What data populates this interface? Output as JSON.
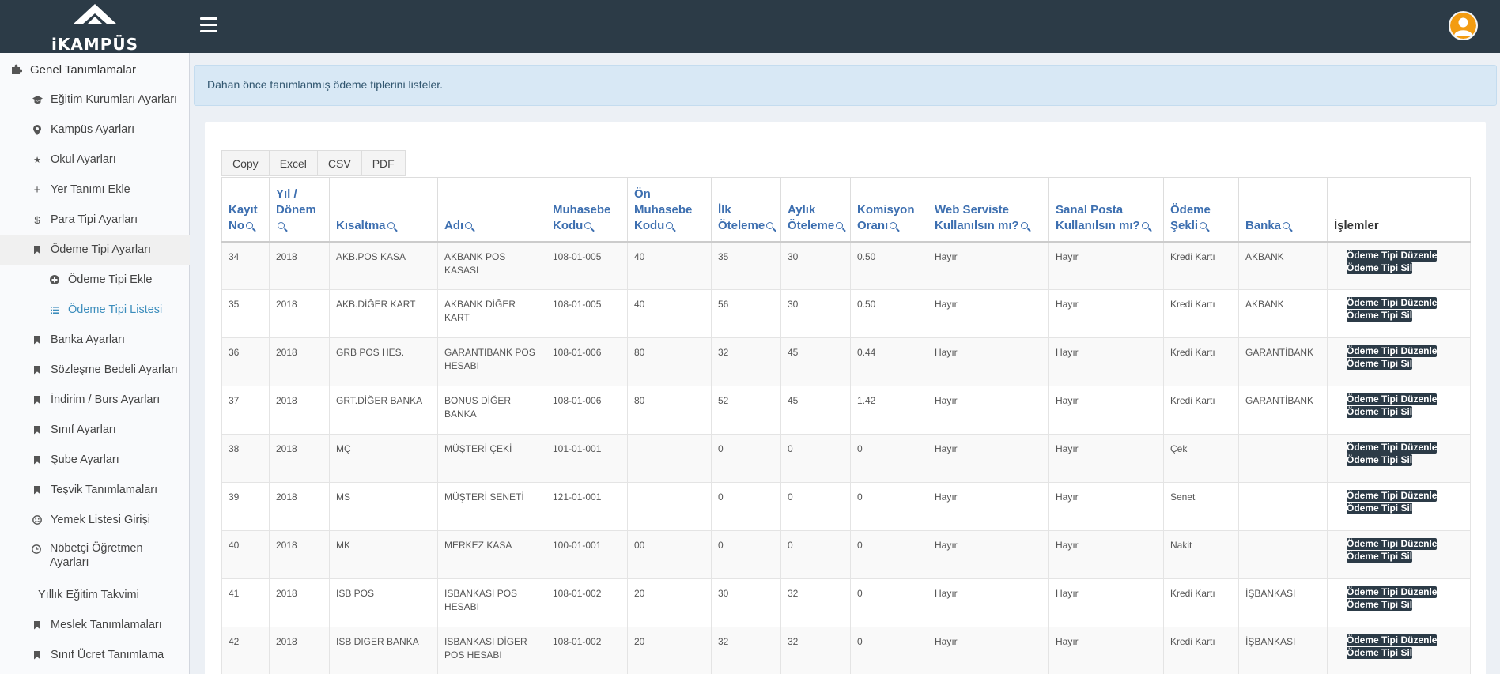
{
  "brand": {
    "logo_text": "iKAMPÜS"
  },
  "sidebar": {
    "items": [
      {
        "label": "Genel Tanımlamalar",
        "icon": "puzzle-icon"
      },
      {
        "label": "Eğitim Kurumları Ayarları",
        "icon": "graduation-cap-icon"
      },
      {
        "label": "Kampüs Ayarları",
        "icon": "map-marker-icon"
      },
      {
        "label": "Okul Ayarları",
        "icon": "star-icon"
      },
      {
        "label": "Yer Tanımı Ekle",
        "icon": "plus-icon"
      },
      {
        "label": "Para Tipi Ayarları",
        "icon": "dollar-icon"
      },
      {
        "label": "Ödeme Tipi Ayarları",
        "icon": "bookmark-icon"
      },
      {
        "label": "Ödeme Tipi Ekle",
        "icon": "plus-circle-icon"
      },
      {
        "label": "Ödeme Tipi Listesi",
        "icon": "list-icon"
      },
      {
        "label": "Banka Ayarları",
        "icon": "bookmark-icon"
      },
      {
        "label": "Sözleşme Bedeli Ayarları",
        "icon": "bookmark-icon"
      },
      {
        "label": "İndirim / Burs Ayarları",
        "icon": "bookmark-icon"
      },
      {
        "label": "Sınıf Ayarları",
        "icon": "bookmark-icon"
      },
      {
        "label": "Şube Ayarları",
        "icon": "bookmark-icon"
      },
      {
        "label": "Teşvik Tanımlamaları",
        "icon": "bookmark-icon"
      },
      {
        "label": "Yemek Listesi Girişi",
        "icon": "smile-icon"
      },
      {
        "label": "Nöbetçi Öğretmen Ayarları",
        "icon": "clock-icon"
      },
      {
        "label": "Yıllık Eğitim Takvimi",
        "icon": ""
      },
      {
        "label": "Meslek Tanımlamaları",
        "icon": "bookmark-icon"
      },
      {
        "label": "Sınıf Ücret Tanımlama",
        "icon": "bookmark-icon"
      }
    ]
  },
  "callout": {
    "text": "Dahan önce tanımlanmış ödeme tiplerini listeler."
  },
  "export_buttons": [
    "Copy",
    "Excel",
    "CSV",
    "PDF"
  ],
  "table": {
    "headers": [
      "Kayıt No",
      "Yıl / Dönem",
      "Kısaltma",
      "Adı",
      "Muhasebe Kodu",
      "Ön Muhasebe Kodu",
      "İlk Öteleme",
      "Aylık Öteleme",
      "Komisyon Oranı",
      "Web Serviste Kullanılsın mı?",
      "Sanal Posta Kullanılsın mı?",
      "Ödeme Şekli",
      "Banka",
      "İşlemler"
    ],
    "rows": [
      [
        "34",
        "2018",
        "AKB.POS KASA",
        "AKBANK POS KASASI",
        "108-01-005",
        "40",
        "35",
        "30",
        "0.50",
        "Hayır",
        "Hayır",
        "Kredi Kartı",
        "AKBANK"
      ],
      [
        "35",
        "2018",
        "AKB.DİĞER KART",
        "AKBANK DİĞER KART",
        "108-01-005",
        "40",
        "56",
        "30",
        "0.50",
        "Hayır",
        "Hayır",
        "Kredi Kartı",
        "AKBANK"
      ],
      [
        "36",
        "2018",
        "GRB POS HES.",
        "GARANTIBANK POS HESABI",
        "108-01-006",
        "80",
        "32",
        "45",
        "0.44",
        "Hayır",
        "Hayır",
        "Kredi Kartı",
        "GARANTİBANK"
      ],
      [
        "37",
        "2018",
        "GRT.DİĞER BANKA",
        "BONUS DİĞER BANKA",
        "108-01-006",
        "80",
        "52",
        "45",
        "1.42",
        "Hayır",
        "Hayır",
        "Kredi Kartı",
        "GARANTİBANK"
      ],
      [
        "38",
        "2018",
        "MÇ",
        "MÜŞTERİ ÇEKİ",
        "101-01-001",
        "",
        "0",
        "0",
        "0",
        "Hayır",
        "Hayır",
        "Çek",
        ""
      ],
      [
        "39",
        "2018",
        "MS",
        "MÜŞTERİ SENETİ",
        "121-01-001",
        "",
        "0",
        "0",
        "0",
        "Hayır",
        "Hayır",
        "Senet",
        ""
      ],
      [
        "40",
        "2018",
        "MK",
        "MERKEZ KASA",
        "100-01-001",
        "00",
        "0",
        "0",
        "0",
        "Hayır",
        "Hayır",
        "Nakit",
        ""
      ],
      [
        "41",
        "2018",
        "ISB POS",
        "ISBANKASI POS HESABI",
        "108-01-002",
        "20",
        "30",
        "32",
        "0",
        "Hayır",
        "Hayır",
        "Kredi Kartı",
        "İŞBANKASI"
      ],
      [
        "42",
        "2018",
        "ISB DIGER BANKA",
        "ISBANKASI DİGER POS HESABI",
        "108-01-002",
        "20",
        "32",
        "32",
        "0",
        "Hayır",
        "Hayır",
        "Kredi Kartı",
        "İŞBANKASI"
      ]
    ],
    "edit_label": "Ödeme Tipi Düzenle",
    "delete_label": "Ödeme Tipi Sil"
  }
}
